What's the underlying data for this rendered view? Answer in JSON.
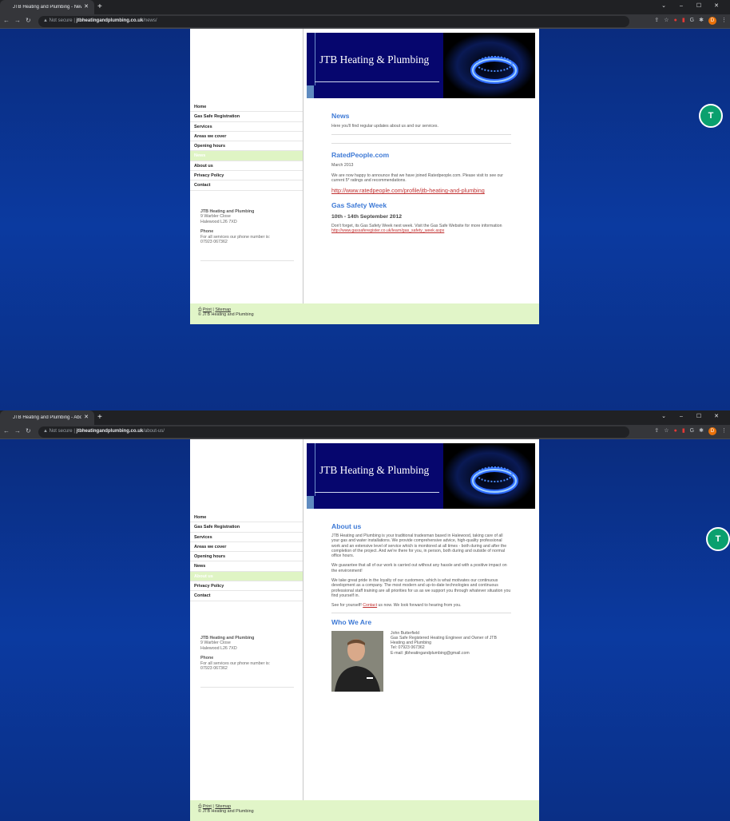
{
  "screen1": {
    "tab_title": "JTB Heating and Plumbing - New",
    "url_warning": "Not secure",
    "url_domain": "jtbheatingandplumbing.co.uk",
    "url_path": "/news/",
    "banner_title": "JTB Heating & Plumbing",
    "menu": [
      "Home",
      "Gas Safe Registration",
      "Services",
      "Areas we cover",
      "Opening hours",
      "News",
      "About us",
      "Privacy Policy",
      "Contact"
    ],
    "active_menu": "News",
    "sidebar": {
      "company": "JTB Heating and Plumbing",
      "addr1": "9 Warbler Close",
      "addr2": "Halewood L26 7XD",
      "phone_label": "Phone",
      "phone_text": "For all services our phone number is:",
      "phone_number": "07923 067362"
    },
    "news_heading": "News",
    "news_intro": "Here you'll find regular updates about us and our services.",
    "rated_heading": "RatedPeople.com",
    "rated_date": "March 2013",
    "rated_text": "We are now happy to announce that we have joined Ratedpeople.com.  Please visit to see our current 5* ratings and recommendations.",
    "rated_link": "http://www.ratedpeople.com/profile/jtb-heating-and-plumbing",
    "gas_heading": "Gas Safety Week",
    "gas_dates": "10th - 14th September 2012",
    "gas_text": "Don't forget, its Gas Safety Week next week.  Visit the Gas Safe Website for more information",
    "gas_link": "http://www.gassaferegister.co.uk/learn/gas_safety_week.aspx",
    "footer_print": "Print",
    "footer_sep": " | ",
    "footer_sitemap": "Sitemap",
    "footer_copy": "© JTB Heating and Plumbing",
    "ext_button": "T"
  },
  "screen2": {
    "tab_title": "JTB Heating and Plumbing - Abo",
    "url_warning": "Not secure",
    "url_domain": "jtbheatingandplumbing.co.uk",
    "url_path": "/about-us/",
    "banner_title": "JTB Heating & Plumbing",
    "menu": [
      "Home",
      "Gas Safe Registration",
      "Services",
      "Areas we cover",
      "Opening hours",
      "News",
      "About us",
      "Privacy Policy",
      "Contact"
    ],
    "active_menu": "About us",
    "sidebar": {
      "company": "JTB Heating and Plumbing",
      "addr1": "9 Warbler Close",
      "addr2": "Halewood L26 7XD",
      "phone_label": "Phone",
      "phone_text": "For all services our phone number is:",
      "phone_number": "07923 067362"
    },
    "about_heading": "About us",
    "about_p1": "JTB Heating and Plumbing is your traditional tradesman based in Halewood, taking care of all your gas and water installations. We provide comprehensive advice, high-quality professional work and an extensive level of service which is monitored at all times - both during and after the completion of the project. And we're there for you, in person, both during and outside of normal office hours.",
    "about_p2": "We guarantee that all of our work is carried out without any hassle and with a positive impact on the environment!",
    "about_p3": "We take great pride in the loyalty of our customers, which is what motivates our continuous development as a company. The most modern and up-to-date technologies and continuous professional staff training are all priorities for us as we support you through whatever situation you find yourself in.",
    "about_p4_pre": "See for yourself! ",
    "about_p4_link": "Contact",
    "about_p4_post": " us now. We look forward to hearing from you.",
    "who_heading": "Who We Are",
    "person_name": "John Butterfield",
    "person_role": "Gas Safe Registered Heating Engineer and Owner of JTB Heating and Plumbing",
    "person_tel": "Tel: 07923 067362",
    "person_email": "E-mail: jtbheatingandplumbing@gmail.com",
    "footer_print": "Print",
    "footer_sep": " | ",
    "footer_sitemap": "Sitemap",
    "footer_copy": "© JTB Heating and Plumbing",
    "ext_button": "T"
  },
  "colors": {
    "heading": "#3e7ad6",
    "banner": "#06066e",
    "active_menu_bg": "#dff4c4",
    "footer_bg": "#e1f5c8",
    "link": "#c03030"
  }
}
